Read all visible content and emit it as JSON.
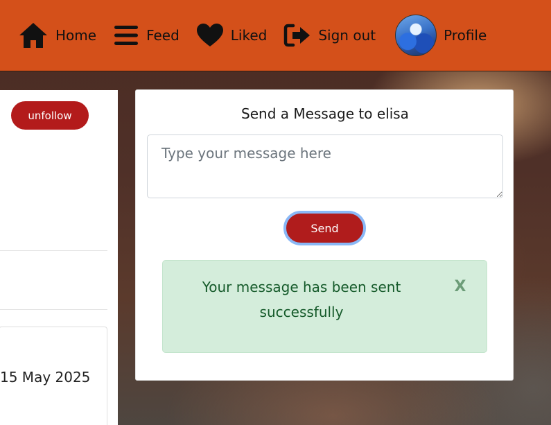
{
  "nav": {
    "home": "Home",
    "feed": "Feed",
    "liked": "Liked",
    "sign_out": "Sign out",
    "profile": "Profile"
  },
  "profile_panel": {
    "unfollow_label": "unfollow",
    "date": "15 May 2025"
  },
  "message": {
    "title": "Send a Message to elisa",
    "placeholder": "Type your message here",
    "send_label": "Send",
    "success_text": "Your message has been sent successfully",
    "close_symbol": "X"
  },
  "colors": {
    "navbar": "#d4501a",
    "button": "#b31b1b",
    "alert_bg": "#d4eddb",
    "alert_text": "#155a2a"
  },
  "icons": [
    "home-icon",
    "menu-icon",
    "heart-icon",
    "sign-out-icon",
    "avatar"
  ]
}
